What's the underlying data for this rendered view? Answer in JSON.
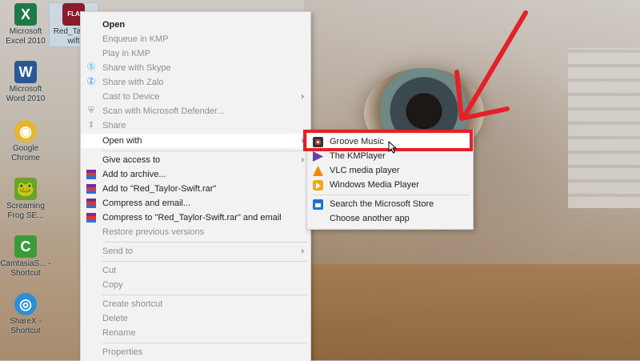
{
  "desktop": {
    "icons": [
      {
        "label": "Microsoft Excel 2010",
        "icon": "excel-icon",
        "color": "#1d7a45",
        "glyph": "X"
      },
      {
        "label": "Red_Taylor wift",
        "icon": "flac-file-icon",
        "color": "#8a1c2b",
        "glyph": "FLA"
      },
      {
        "label": "Microsoft Word 2010",
        "icon": "word-icon",
        "color": "#2b5797",
        "glyph": "W"
      },
      {
        "label": "Google Chrome",
        "icon": "chrome-icon",
        "color": "#e8b62b",
        "glyph": "◉"
      },
      {
        "label": "Screaming Frog SE...",
        "icon": "screaming-frog-icon",
        "color": "#6aa329",
        "glyph": "🐸"
      },
      {
        "label": "CamtasiaS... - Shortcut",
        "icon": "camtasia-icon",
        "color": "#3a9b3a",
        "glyph": "C"
      },
      {
        "label": "ShareX - Shortcut",
        "icon": "sharex-icon",
        "color": "#2d8fd6",
        "glyph": "◎"
      }
    ]
  },
  "context_menu": {
    "items": [
      {
        "label": "Open",
        "bold": true,
        "disabled": false
      },
      {
        "label": "Enqueue in KMP",
        "disabled": true
      },
      {
        "label": "Play in KMP",
        "disabled": true
      },
      {
        "label": "Share with Skype",
        "disabled": true,
        "icon": "skype-icon"
      },
      {
        "label": "Share with Zalo",
        "disabled": true,
        "icon": "zalo-icon"
      },
      {
        "label": "Cast to Device",
        "disabled": true,
        "submenu": true
      },
      {
        "label": "Scan with Microsoft Defender...",
        "disabled": true,
        "icon": "defender-icon"
      },
      {
        "label": "Share",
        "disabled": true,
        "icon": "share-icon"
      },
      {
        "label": "Open with",
        "disabled": false,
        "submenu": true,
        "hover": true
      },
      {
        "label": "Give access to",
        "disabled": false,
        "submenu": true
      },
      {
        "label": "Add to archive...",
        "disabled": false,
        "icon": "winrar-icon"
      },
      {
        "label": "Add to \"Red_Taylor-Swift.rar\"",
        "disabled": false,
        "icon": "winrar-icon"
      },
      {
        "label": "Compress and email...",
        "disabled": false,
        "icon": "winrar-icon"
      },
      {
        "label": "Compress to \"Red_Taylor-Swift.rar\" and email",
        "disabled": false,
        "icon": "winrar-icon"
      },
      {
        "label": "Restore previous versions",
        "disabled": true
      },
      {
        "label": "Send to",
        "disabled": true,
        "submenu": true
      },
      {
        "label": "Cut",
        "disabled": true
      },
      {
        "label": "Copy",
        "disabled": true
      },
      {
        "label": "Create shortcut",
        "disabled": true
      },
      {
        "label": "Delete",
        "disabled": true
      },
      {
        "label": "Rename",
        "disabled": true
      },
      {
        "label": "Properties",
        "disabled": true
      }
    ]
  },
  "open_with_submenu": {
    "items": [
      {
        "label": "Groove Music",
        "icon": "groove-music-icon",
        "highlighted": true
      },
      {
        "label": "The KMPlayer",
        "icon": "kmplayer-icon"
      },
      {
        "label": "VLC media player",
        "icon": "vlc-icon"
      },
      {
        "label": "Windows Media Player",
        "icon": "windows-media-player-icon"
      },
      {
        "label": "Search the Microsoft Store",
        "icon": "microsoft-store-icon"
      },
      {
        "label": "Choose another app"
      }
    ]
  },
  "colors": {
    "annotation_red": "#e32127",
    "menu_background": "#f2f2f2",
    "disabled_text": "#8e8e8e"
  }
}
